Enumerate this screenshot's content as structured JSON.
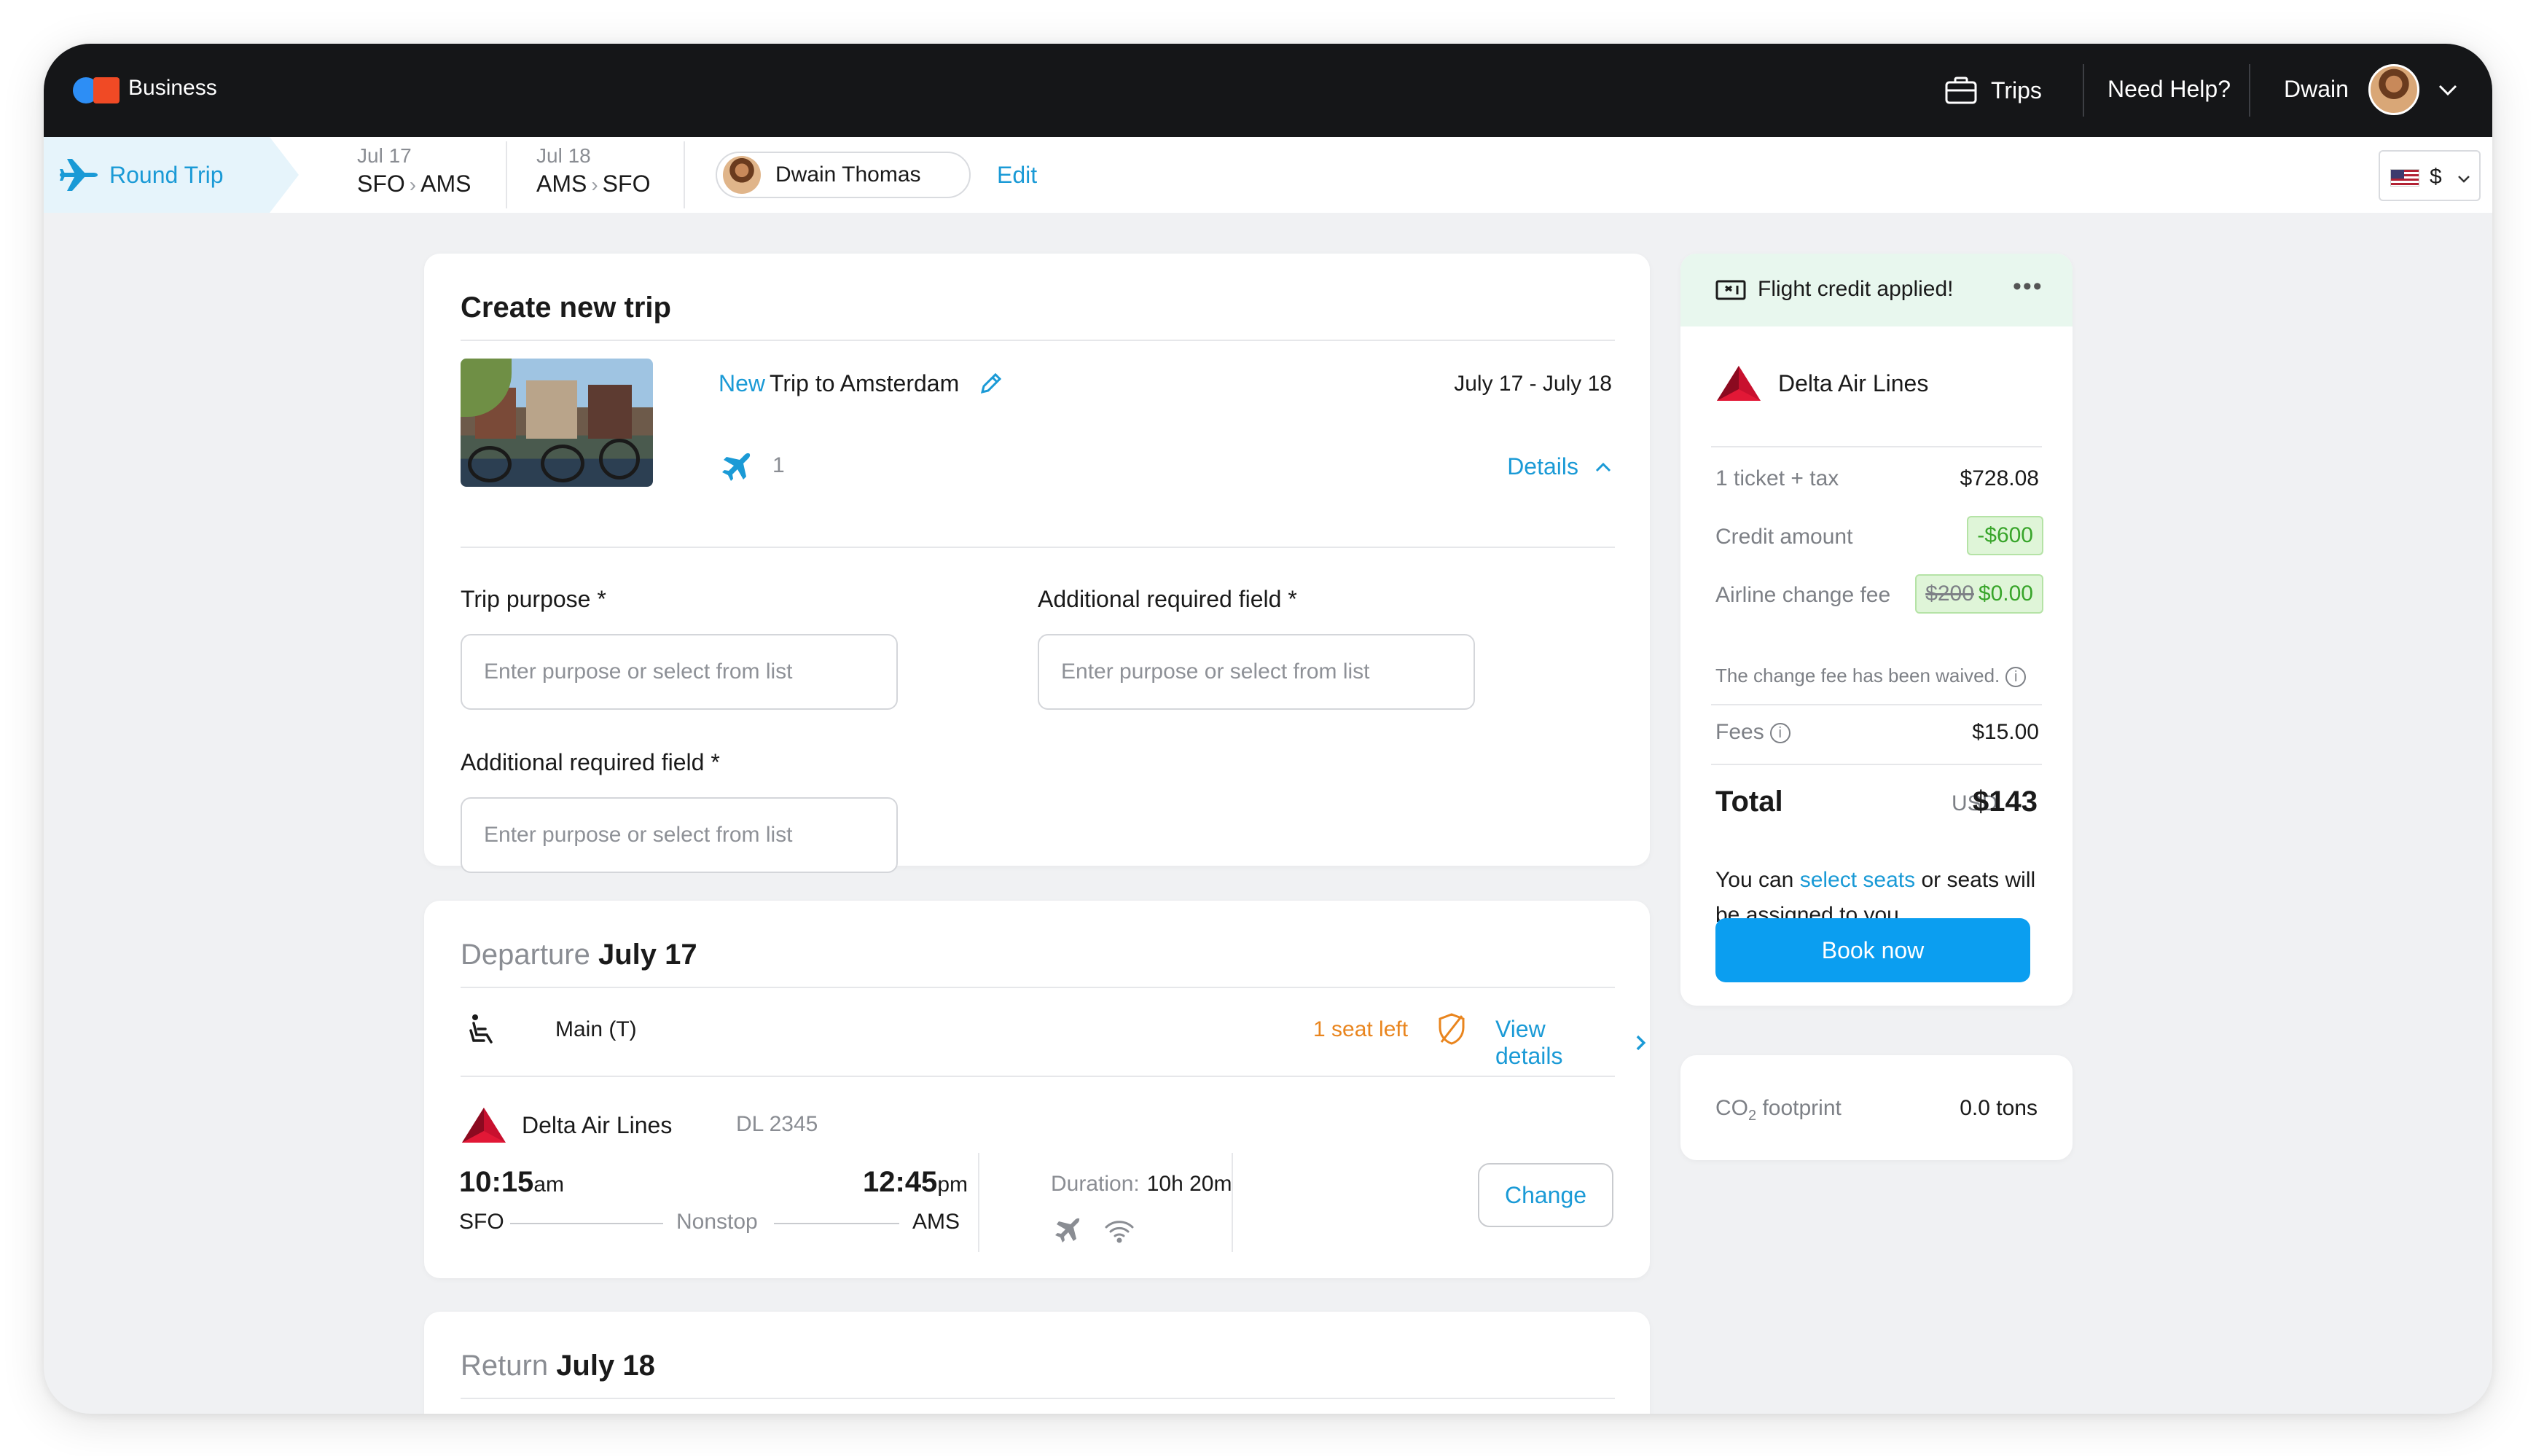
{
  "header": {
    "brand": "Business",
    "trips_label": "Trips",
    "help_label": "Need Help?",
    "user_name": "Dwain"
  },
  "subbar": {
    "trip_type": "Round Trip",
    "legs": [
      {
        "date": "Jul 17",
        "from": "SFO",
        "to": "AMS"
      },
      {
        "date": "Jul 18",
        "from": "AMS",
        "to": "SFO"
      }
    ],
    "traveler_name": "Dwain Thomas",
    "edit_label": "Edit",
    "currency_symbol": "$"
  },
  "trip_card": {
    "title": "Create new trip",
    "new_tag": "New",
    "trip_name": "Trip to Amsterdam",
    "dates": "July 17 - July 18",
    "flight_count": "1",
    "details_label": "Details",
    "fields": [
      {
        "label": "Trip purpose *",
        "placeholder": "Enter purpose or select from list"
      },
      {
        "label": "Additional required field *",
        "placeholder": "Enter purpose or select from list"
      },
      {
        "label": "Additional required field *",
        "placeholder": "Enter purpose or select from list"
      }
    ]
  },
  "departure": {
    "heading": "Departure",
    "date": "July 17",
    "cabin": "Main (T)",
    "seats_left": "1 seat left",
    "view_details": "View details",
    "airline": "Delta Air Lines",
    "flight_number": "DL 2345",
    "depart_time": "10:15",
    "depart_ampm": "am",
    "arrive_time": "12:45",
    "arrive_ampm": "pm",
    "origin": "SFO",
    "destination": "AMS",
    "stops": "Nonstop",
    "duration_label": "Duration:",
    "duration_value": "10h 20m",
    "change_label": "Change"
  },
  "return": {
    "heading": "Return",
    "date": "July 18"
  },
  "summary": {
    "credit_banner": "Flight credit applied!",
    "more": "•••",
    "airline": "Delta Air Lines",
    "rows": {
      "ticket_label": "1 ticket + tax",
      "ticket_value": "$728.08",
      "credit_label": "Credit amount",
      "credit_value": "-$600",
      "change_fee_label": "Airline change fee",
      "change_fee_old": "$200",
      "change_fee_new": "$0.00",
      "waived_note": "The change fee has been waived.",
      "fees_label": "Fees",
      "fees_value": "$15.00"
    },
    "total_label": "Total",
    "total_currency": "USD",
    "total_value": "$143",
    "seats_prefix": "You can",
    "seats_link": "select seats",
    "seats_suffix": "or seats will be assigned to you",
    "book_label": "Book now"
  },
  "co2": {
    "label_prefix": "CO",
    "label_sub": "2",
    "label_suffix": " footprint",
    "value": "0.0 tons"
  },
  "colors": {
    "accent": "#1a9ad6",
    "topbar": "#151618",
    "book_button": "#0b9ef0",
    "warning": "#e9851e",
    "credit_green": "#38a52a",
    "delta_red": "#c8102e"
  }
}
